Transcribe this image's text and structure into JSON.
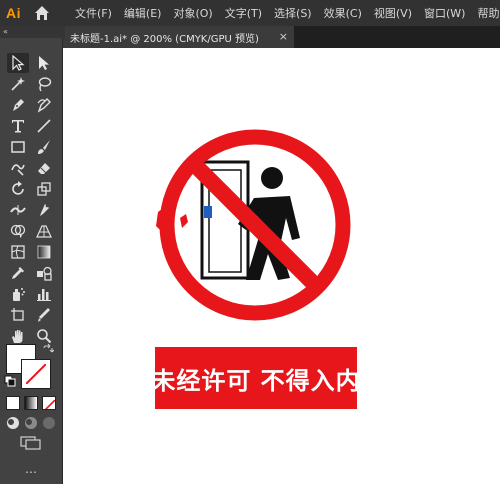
{
  "app": {
    "logo": "Ai"
  },
  "menu": [
    "文件(F)",
    "编辑(E)",
    "对象(O)",
    "文字(T)",
    "选择(S)",
    "效果(C)",
    "视图(V)",
    "窗口(W)",
    "帮助(H)"
  ],
  "document_tab": {
    "title": "未标题-1.ai* @ 200% (CMYK/GPU 预览)",
    "close": "×"
  },
  "toolbar": {
    "collapse": "«",
    "more": "…",
    "tools": [
      "selection-tool",
      "direct-selection-tool",
      "magic-wand-tool",
      "lasso-tool",
      "pen-tool",
      "curvature-tool",
      "type-tool",
      "line-segment-tool",
      "rectangle-tool",
      "paintbrush-tool",
      "shaper-tool",
      "eraser-tool",
      "rotate-tool",
      "scale-tool",
      "width-tool",
      "puppet-warp-tool",
      "shape-builder-tool",
      "perspective-grid-tool",
      "mesh-tool",
      "gradient-tool",
      "eyedropper-tool",
      "blend-tool",
      "symbol-sprayer-tool",
      "column-graph-tool",
      "artboard-tool",
      "slice-tool",
      "hand-tool",
      "zoom-tool"
    ],
    "fill_color": "#ffffff",
    "stroke_color": "none"
  },
  "artwork": {
    "sign_text": "未经许可 不得入内",
    "sign_color": "#e6161b"
  }
}
